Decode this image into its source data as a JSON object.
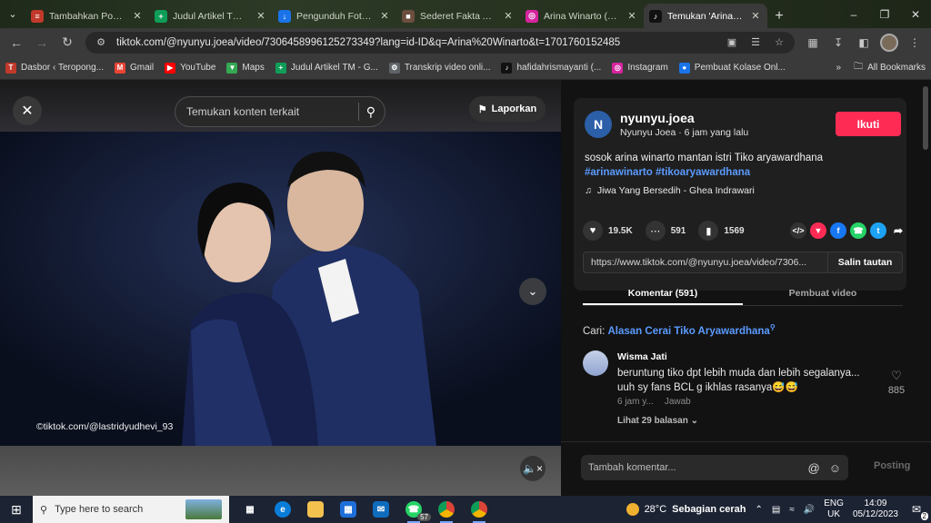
{
  "browser": {
    "tabs": [
      {
        "label": "Tambahkan Pos Bar",
        "fav_color": "#c0392b",
        "fav": "≡",
        "active": false
      },
      {
        "label": "Judul Artikel TM - G",
        "fav_color": "#0f9d58",
        "fav": "+",
        "active": false
      },
      {
        "label": "Pengunduh Foto Gra",
        "fav_color": "#1a73e8",
        "fav": "↓",
        "active": false
      },
      {
        "label": "Sederet Fakta Arina",
        "fav_color": "#6b4e3d",
        "fav": "■",
        "active": false
      },
      {
        "label": "Arina Winarto (@ari",
        "fav_color": "#d6249f",
        "fav": "◎",
        "active": false
      },
      {
        "label": "Temukan 'Arina Wina",
        "fav_color": "#111111",
        "fav": "♪",
        "active": true
      }
    ],
    "url": "tiktok.com/@nyunyu.joea/video/7306458996125273349?lang=id-ID&q=Arina%20Winarto&t=1701760152485",
    "bookmarks": [
      {
        "label": "Dasbor ‹ Teropong...",
        "color": "#c0392b",
        "fav": "T"
      },
      {
        "label": "Gmail",
        "color": "#ea4335",
        "fav": "M"
      },
      {
        "label": "YouTube",
        "color": "#ff0000",
        "fav": "▶"
      },
      {
        "label": "Maps",
        "color": "#34a853",
        "fav": "▼"
      },
      {
        "label": "Judul Artikel TM - G...",
        "color": "#0f9d58",
        "fav": "+"
      },
      {
        "label": "Transkrip video onli...",
        "color": "#5f6368",
        "fav": "⚙"
      },
      {
        "label": "hafidahrismayanti (...",
        "color": "#111111",
        "fav": "♪"
      },
      {
        "label": "Instagram",
        "color": "#d6249f",
        "fav": "◎"
      },
      {
        "label": "Pembuat Kolase Onl...",
        "color": "#1a73e8",
        "fav": "●"
      }
    ],
    "all_bookmarks": "All Bookmarks"
  },
  "video": {
    "search_placeholder": "Temukan konten terkait",
    "report_label": "Laporkan",
    "watermark": "©tiktok.com/@lastridyudhevi_93"
  },
  "author": {
    "initial": "N",
    "handle": "nyunyu.joea",
    "subline": "Nyunyu Joea · 6 jam yang lalu",
    "follow_label": "Ikuti",
    "caption_text": "sosok arina winarto mantan istri Tiko aryawardhana",
    "hashtags": "#arinawinarto #tikoaryawardhana",
    "music": "Jiwa Yang Bersedih - Ghea Indrawari"
  },
  "stats": {
    "likes": "19.5K",
    "comments": "591",
    "saves": "1569"
  },
  "share": {
    "url": "https://www.tiktok.com/@nyunyu.joea/video/7306...",
    "copy_label": "Salin tautan"
  },
  "panel_tabs": {
    "comments": "Komentar (591)",
    "creator_videos": "Pembuat video"
  },
  "search_suggestion": {
    "prefix": "Cari:",
    "query": "Alasan Cerai Tiko Aryawardhana"
  },
  "comment": {
    "name": "Wisma Jati",
    "text": "beruntung tiko dpt lebih muda dan lebih segalanya... uuh sy fans BCL g ikhlas rasanya😅😅",
    "time": "6 jam y...",
    "reply": "Jawab",
    "replies": "Lihat 29 balasan",
    "likes": "885"
  },
  "composer": {
    "placeholder": "Tambah komentar...",
    "post_label": "Posting"
  },
  "taskbar": {
    "search_placeholder": "Type here to search",
    "whatsapp_badge": "57",
    "weather_temp": "28°C",
    "weather_text": "Sebagian cerah",
    "lang_top": "ENG",
    "lang_bottom": "UK",
    "time": "14:09",
    "date": "05/12/2023",
    "notif_count": "2"
  }
}
